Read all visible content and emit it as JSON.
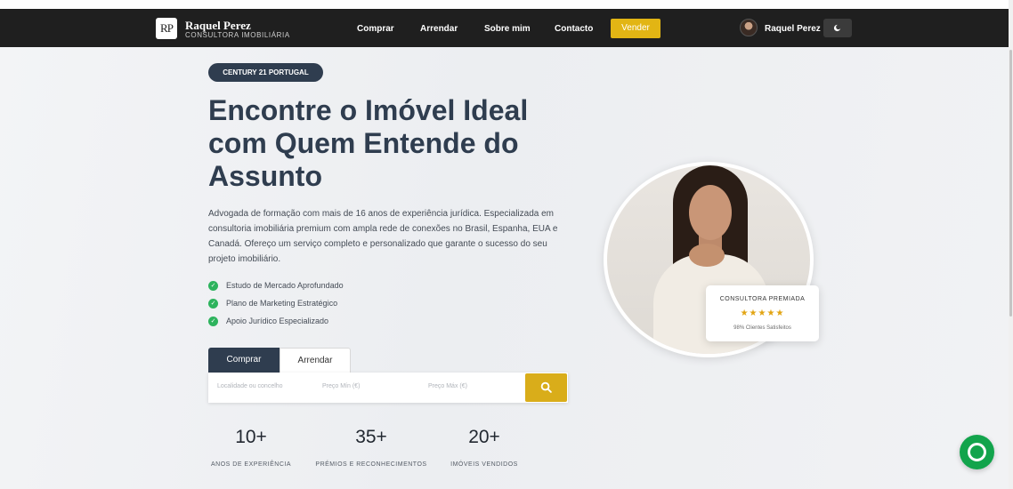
{
  "header": {
    "logo_monogram": "RP",
    "brand_name": "Raquel Perez",
    "brand_subtitle": "CONSULTORA IMOBILIÁRIA",
    "nav": [
      "Comprar",
      "Arrendar",
      "Sobre mim",
      "Contacto"
    ],
    "cta_label": "Vender",
    "user_name": "Raquel Perez",
    "theme_toggle_icon": "theme-toggle-icon"
  },
  "hero": {
    "badge": "CENTURY 21 PORTUGAL",
    "title": "Encontre o Imóvel Ideal com Quem Entende do Assunto",
    "description": "Advogada de formação com mais de 16 anos de experiência jurídica. Especializada em consultoria imobiliária premium com ampla rede de conexões no Brasil, Espanha, EUA e Canadá. Ofereço um serviço completo e personalizado que garante o sucesso do seu projeto imobiliário.",
    "features": [
      "Estudo de Mercado Aprofundado",
      "Plano de Marketing Estratégico",
      "Apoio Jurídico Especializado"
    ]
  },
  "search": {
    "tabs": [
      "Comprar",
      "Arrendar"
    ],
    "active_tab": "Comprar",
    "location_placeholder": "Localidade ou concelho",
    "min_price_placeholder": "Preço Mín (€)",
    "max_price_placeholder": "Preço Máx (€)",
    "button_icon": "search-icon"
  },
  "stats": [
    {
      "value": "10+",
      "label": "ANOS DE EXPERIÊNCIA"
    },
    {
      "value": "35+",
      "label": "PRÉMIOS E RECONHECIMENTOS"
    },
    {
      "value": "20+",
      "label": "IMÓVEIS VENDIDOS"
    }
  ],
  "award": {
    "title": "CONSULTORA PREMIADA",
    "stars": "★★★★★",
    "subtitle": "98% Clientes Satisfeitos"
  },
  "colors": {
    "dark": "#2f3d4f",
    "nav_bg": "#1f1f1f",
    "accent_gold": "#e2b514",
    "check_green": "#2db35d",
    "chat_green": "#12a44c"
  }
}
